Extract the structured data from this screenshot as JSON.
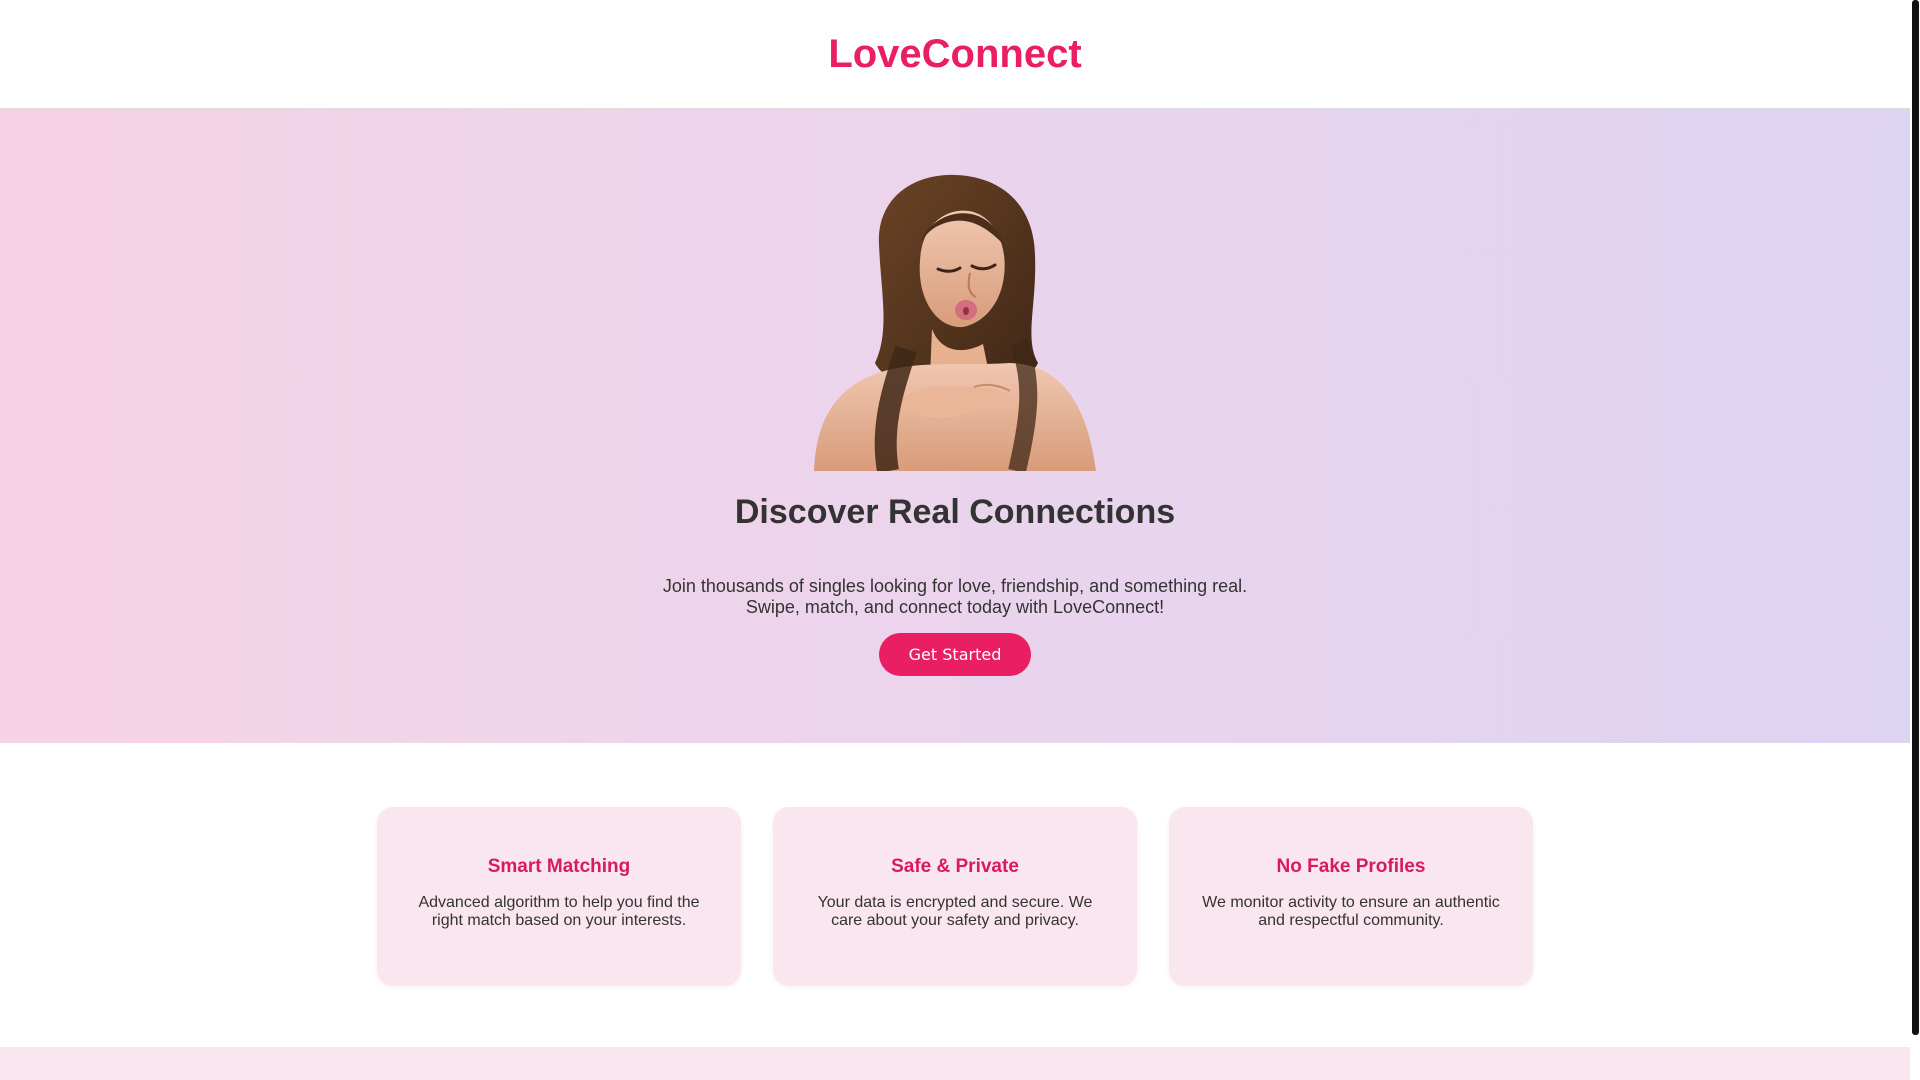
{
  "brand": {
    "name": "LoveConnect"
  },
  "hero": {
    "image_alt": "woman blowing a kiss",
    "title": "Discover Real Connections",
    "copy_line1": "Join thousands of singles looking for love, friendship, and something real.",
    "copy_line2": "Swipe, match, and connect today with LoveConnect!",
    "cta_label": "Get Started"
  },
  "features": [
    {
      "title": "Smart Matching",
      "copy": "Advanced algorithm to help you find the right match based on your interests."
    },
    {
      "title": "Safe & Private",
      "copy": "Your data is encrypted and secure. We care about your safety and privacy."
    },
    {
      "title": "No Fake Profiles",
      "copy": "We monitor activity to ensure an authentic and respectful community."
    }
  ],
  "colors": {
    "accent": "#e91e63",
    "card_title": "#d81b60",
    "card_bg": "#f9e6ee",
    "hero_left": "#f6d3e4",
    "hero_right": "#ddd3f2"
  }
}
